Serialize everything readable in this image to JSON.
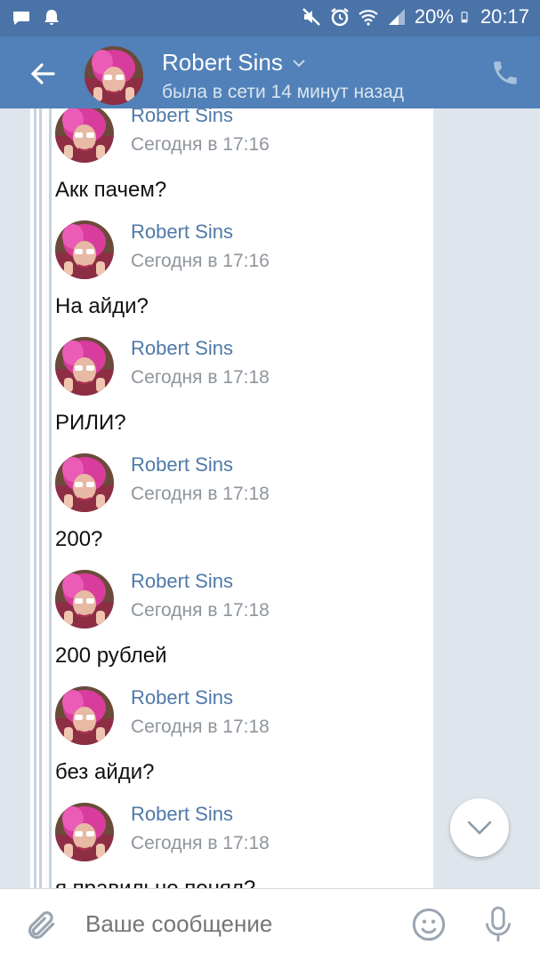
{
  "status_bar": {
    "battery": "20%",
    "time": "20:17",
    "left_icons": [
      "chat-bubble-icon",
      "bell-icon"
    ],
    "right_icons": [
      "mute-icon",
      "alarm-icon",
      "wifi-icon",
      "signal-icon",
      "battery-icon"
    ]
  },
  "header": {
    "title": "Robert Sins",
    "subtitle": "была в сети 14 минут назад",
    "icons": [
      "back-arrow-icon",
      "chevron-down-icon",
      "phone-icon"
    ]
  },
  "messages": [
    {
      "name": "Robert Sins",
      "time": "Сегодня в 17:16",
      "text": "Акк пачем?"
    },
    {
      "name": "Robert Sins",
      "time": "Сегодня в 17:16",
      "text": "На айди?"
    },
    {
      "name": "Robert Sins",
      "time": "Сегодня в 17:18",
      "text": "РИЛИ?"
    },
    {
      "name": "Robert Sins",
      "time": "Сегодня в 17:18",
      "text": "200?"
    },
    {
      "name": "Robert Sins",
      "time": "Сегодня в 17:18",
      "text": "200 рублей"
    },
    {
      "name": "Robert Sins",
      "time": "Сегодня в 17:18",
      "text": "без айди?"
    },
    {
      "name": "Robert Sins",
      "time": "Сегодня в 17:18",
      "text": "я правильно понял?"
    }
  ],
  "composer": {
    "placeholder": "Ваше сообщение",
    "icons": [
      "paperclip-icon",
      "smile-icon",
      "microphone-icon"
    ]
  },
  "colors": {
    "header_bg": "#5181b8",
    "status_bg": "#4a73a8",
    "name_color": "#4f79a8",
    "chat_bg": "#dfe5ec"
  }
}
